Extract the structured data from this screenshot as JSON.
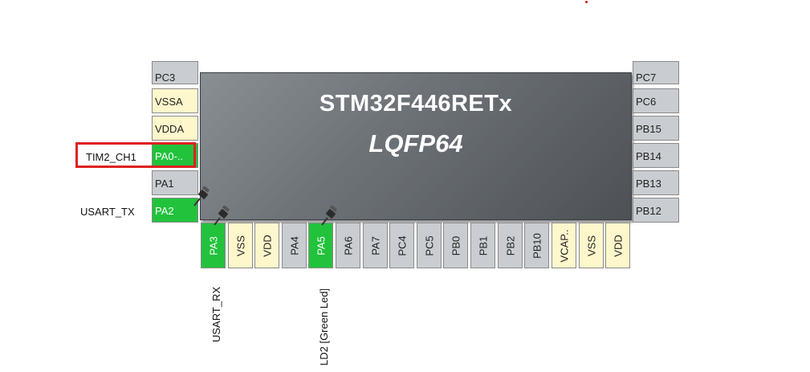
{
  "chip": {
    "name": "STM32F446RETx",
    "package": "LQFP64"
  },
  "left_pins": [
    {
      "label": "PC3",
      "state": "grey"
    },
    {
      "label": "VSSA",
      "state": "cream"
    },
    {
      "label": "VDDA",
      "state": "cream"
    },
    {
      "label": "PA0-..",
      "state": "green"
    },
    {
      "label": "PA1",
      "state": "grey"
    },
    {
      "label": "PA2",
      "state": "green"
    }
  ],
  "right_pins": [
    {
      "label": "PC7",
      "state": "grey"
    },
    {
      "label": "PC6",
      "state": "grey"
    },
    {
      "label": "PB15",
      "state": "grey"
    },
    {
      "label": "PB14",
      "state": "grey"
    },
    {
      "label": "PB13",
      "state": "grey"
    },
    {
      "label": "PB12",
      "state": "grey"
    }
  ],
  "bottom_pins": [
    {
      "label": "PA3",
      "state": "green"
    },
    {
      "label": "VSS",
      "state": "cream"
    },
    {
      "label": "VDD",
      "state": "cream"
    },
    {
      "label": "PA4",
      "state": "grey"
    },
    {
      "label": "PA5",
      "state": "green"
    },
    {
      "label": "PA6",
      "state": "grey"
    },
    {
      "label": "PA7",
      "state": "grey"
    },
    {
      "label": "PC4",
      "state": "grey"
    },
    {
      "label": "PC5",
      "state": "grey"
    },
    {
      "label": "PB0",
      "state": "grey"
    },
    {
      "label": "PB1",
      "state": "grey"
    },
    {
      "label": "PB2",
      "state": "grey"
    },
    {
      "label": "PB10",
      "state": "grey"
    },
    {
      "label": "VCAP..",
      "state": "cream"
    },
    {
      "label": "VSS",
      "state": "cream"
    },
    {
      "label": "VDD",
      "state": "cream"
    }
  ],
  "signals": {
    "pa0": "TIM2_CH1",
    "pa2": "USART_TX",
    "pa3": "USART_RX",
    "pa5": "LD2 [Green Led]"
  },
  "colors": {
    "assigned_pin": "#22c23c",
    "power_pin": "#fff7cc",
    "unassigned_pin": "#c9cdd1",
    "selection_border": "#e02020"
  }
}
